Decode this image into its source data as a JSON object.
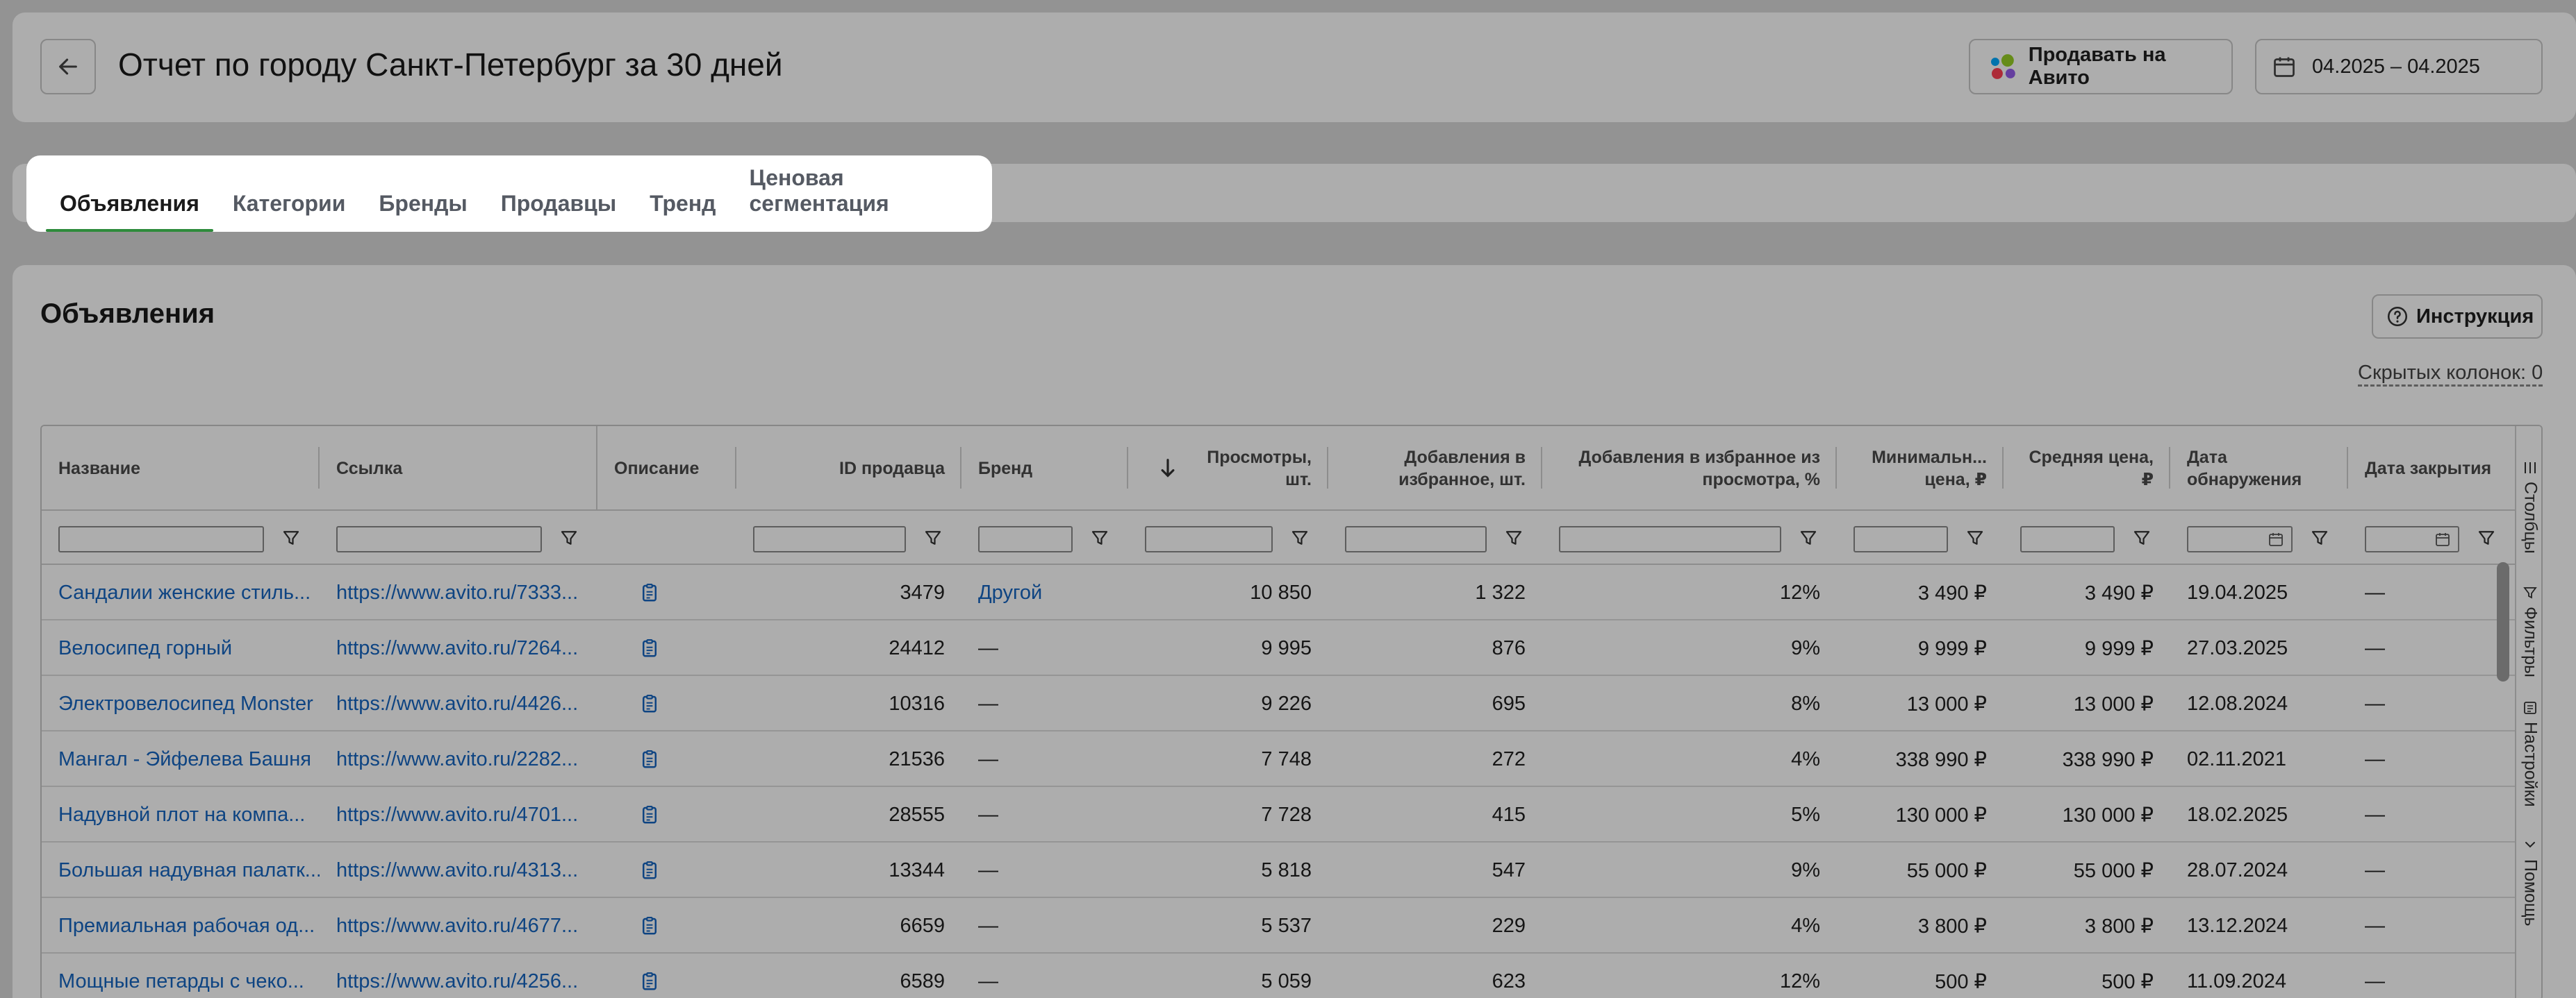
{
  "header": {
    "title": "Отчет по городу Санкт-Петербург за 30 дней",
    "avito_button": "Продавать на Авито",
    "date_range": "04.2025 – 04.2025"
  },
  "tabs": [
    {
      "label": "Объявления",
      "active": true
    },
    {
      "label": "Категории",
      "active": false
    },
    {
      "label": "Бренды",
      "active": false
    },
    {
      "label": "Продавцы",
      "active": false
    },
    {
      "label": "Тренд",
      "active": false
    },
    {
      "label": "Ценовая сегментация",
      "active": false
    }
  ],
  "section": {
    "title": "Объявления",
    "help_button": "Инструкция",
    "hidden_columns": "Скрытых колонок: 0"
  },
  "table": {
    "columns": [
      {
        "label": "Название"
      },
      {
        "label": "Ссылка"
      },
      {
        "label": "Описание"
      },
      {
        "label": "ID продавца"
      },
      {
        "label": "Бренд"
      },
      {
        "label": "Просмотры, шт.",
        "sorted": "desc"
      },
      {
        "label": "Добавления в избранное, шт."
      },
      {
        "label": "Добавления в избранное из просмотра, %"
      },
      {
        "label": "Минимальн... цена, ₽"
      },
      {
        "label": "Средняя цена, ₽"
      },
      {
        "label": "Дата обнаружения"
      },
      {
        "label": "Дата закрытия"
      }
    ],
    "rows": [
      {
        "name": "Сандалии женские стиль...",
        "link": "https://www.avito.ru/7333...",
        "seller_id": "3479",
        "brand": "Другой",
        "views": "10 850",
        "favs": "1 322",
        "fav_pct": "12%",
        "min_price": "3 490 ₽",
        "avg_price": "3 490 ₽",
        "found": "19.04.2025",
        "closed": "—"
      },
      {
        "name": "Велосипед горный",
        "link": "https://www.avito.ru/7264...",
        "seller_id": "24412",
        "brand": "—",
        "views": "9 995",
        "favs": "876",
        "fav_pct": "9%",
        "min_price": "9 999 ₽",
        "avg_price": "9 999 ₽",
        "found": "27.03.2025",
        "closed": "—"
      },
      {
        "name": "Электровелосипед Monster",
        "link": "https://www.avito.ru/4426...",
        "seller_id": "10316",
        "brand": "—",
        "views": "9 226",
        "favs": "695",
        "fav_pct": "8%",
        "min_price": "13 000 ₽",
        "avg_price": "13 000 ₽",
        "found": "12.08.2024",
        "closed": "—"
      },
      {
        "name": "Мангал - Эйфелева Башня",
        "link": "https://www.avito.ru/2282...",
        "seller_id": "21536",
        "brand": "—",
        "views": "7 748",
        "favs": "272",
        "fav_pct": "4%",
        "min_price": "338 990 ₽",
        "avg_price": "338 990 ₽",
        "found": "02.11.2021",
        "closed": "—"
      },
      {
        "name": "Надувной плот на компа...",
        "link": "https://www.avito.ru/4701...",
        "seller_id": "28555",
        "brand": "—",
        "views": "7 728",
        "favs": "415",
        "fav_pct": "5%",
        "min_price": "130 000 ₽",
        "avg_price": "130 000 ₽",
        "found": "18.02.2025",
        "closed": "—"
      },
      {
        "name": "Большая надувная палатк...",
        "link": "https://www.avito.ru/4313...",
        "seller_id": "13344",
        "brand": "—",
        "views": "5 818",
        "favs": "547",
        "fav_pct": "9%",
        "min_price": "55 000 ₽",
        "avg_price": "55 000 ₽",
        "found": "28.07.2024",
        "closed": "—"
      },
      {
        "name": "Премиальная рабочая од...",
        "link": "https://www.avito.ru/4677...",
        "seller_id": "6659",
        "brand": "—",
        "views": "5 537",
        "favs": "229",
        "fav_pct": "4%",
        "min_price": "3 800 ₽",
        "avg_price": "3 800 ₽",
        "found": "13.12.2024",
        "closed": "—"
      },
      {
        "name": "Мощные петарды с чеко...",
        "link": "https://www.avito.ru/4256...",
        "seller_id": "6589",
        "brand": "—",
        "views": "5 059",
        "favs": "623",
        "fav_pct": "12%",
        "min_price": "500 ₽",
        "avg_price": "500 ₽",
        "found": "11.09.2024",
        "closed": "—"
      }
    ]
  },
  "sidebar": [
    {
      "label": "Столбцы",
      "icon": "columns-icon"
    },
    {
      "label": "Фильтры",
      "icon": "filter-icon"
    },
    {
      "label": "Настройки",
      "icon": "settings-icon"
    },
    {
      "label": "Помощь",
      "icon": "help-icon"
    }
  ],
  "colors": {
    "overlay": "#000000",
    "active_tab_underline": "#2e8b3b",
    "link": "#1565c0",
    "avito_dots": [
      "#97cf26",
      "#0af",
      "#ff4053",
      "#965eeb"
    ]
  }
}
